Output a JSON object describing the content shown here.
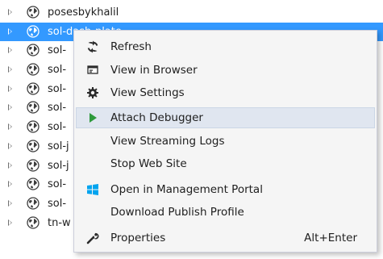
{
  "tree": {
    "items": [
      {
        "label": "posesbykhalil",
        "selected": false
      },
      {
        "label": "sol-dash-plate",
        "selected": true
      },
      {
        "label": "sol-",
        "selected": false
      },
      {
        "label": "sol-",
        "selected": false
      },
      {
        "label": "sol-",
        "selected": false
      },
      {
        "label": "sol-",
        "selected": false
      },
      {
        "label": "sol-",
        "selected": false
      },
      {
        "label": "sol-j",
        "selected": false
      },
      {
        "label": "sol-j",
        "selected": false
      },
      {
        "label": "sol-",
        "selected": false
      },
      {
        "label": "sol-",
        "selected": false
      },
      {
        "label": "tn-w",
        "selected": false
      }
    ]
  },
  "context_menu": {
    "items": [
      {
        "label": "Refresh",
        "icon": "refresh-icon"
      },
      {
        "label": "View in Browser",
        "icon": "browser-icon"
      },
      {
        "label": "View Settings",
        "icon": "gear-icon"
      },
      {
        "label": "Attach Debugger",
        "icon": "play-icon",
        "highlighted": true
      },
      {
        "label": "View Streaming Logs",
        "icon": ""
      },
      {
        "label": "Stop Web Site",
        "icon": ""
      },
      {
        "label": "Open in Management Portal",
        "icon": "windows-logo-icon"
      },
      {
        "label": "Download Publish Profile",
        "icon": ""
      },
      {
        "label": "Properties",
        "icon": "wrench-icon",
        "shortcut": "Alt+Enter"
      }
    ]
  },
  "colors": {
    "selection": "#3399ff",
    "menu_background": "#f5f5f5",
    "menu_highlight": "#e0e6f0",
    "debugger_green": "#2e9a3c",
    "windows_blue": "#00a4ef"
  }
}
